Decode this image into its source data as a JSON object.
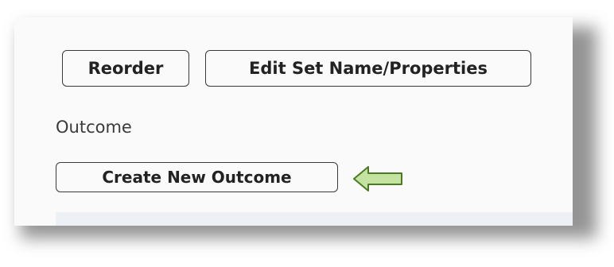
{
  "toolbar": {
    "reorder_label": "Reorder",
    "edit_label": "Edit Set Name/Properties"
  },
  "outcome": {
    "section_label": "Outcome",
    "create_label": "Create New Outcome"
  },
  "colors": {
    "arrow_fill": "#c5e3a0",
    "arrow_stroke": "#4c7a24",
    "button_border": "#3a3a3a",
    "content_strip": "#edf1f5"
  },
  "icons": {
    "pointer": "left-arrow-icon"
  }
}
